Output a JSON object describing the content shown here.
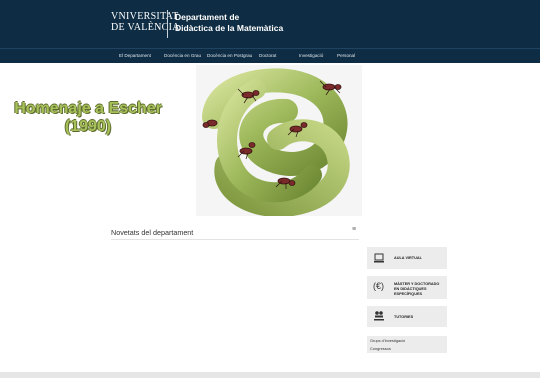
{
  "header": {
    "logo_line1": "VNIVERSITAT",
    "logo_line2": "DE VALÈNCIA",
    "dept_line1": "Departament de",
    "dept_line2": "Didàctica de la Matemàtica"
  },
  "nav": {
    "items": [
      "El Departament",
      "Docència en Grau",
      "Docència en Postgrau",
      "Doctorat",
      "Investigació",
      "Personal"
    ]
  },
  "hero": {
    "title_line1": "Homenaje a Escher",
    "title_line2": "(1990)"
  },
  "news": {
    "title": "Novetats del departament",
    "menu_icon": "≡"
  },
  "sidebar": {
    "buttons": [
      {
        "label_line1": "AULA VIRTUAL",
        "label_line2": "",
        "icon": "laptop-icon"
      },
      {
        "label_line1": "MÀSTER Y DOCTORADO",
        "label_line2": "EN DIDÁCTIQUES ESPECÍFIQUES",
        "icon": "euro-icon"
      },
      {
        "label_line1": "TUTORIES",
        "label_line2": "",
        "icon": "people-icon"
      }
    ],
    "links": [
      "Grups d'Investigació",
      "Congressos"
    ]
  },
  "colors": {
    "header_bg": "#0e2d44",
    "hero_title": "#a7c15a",
    "side_bg": "#ececec"
  }
}
